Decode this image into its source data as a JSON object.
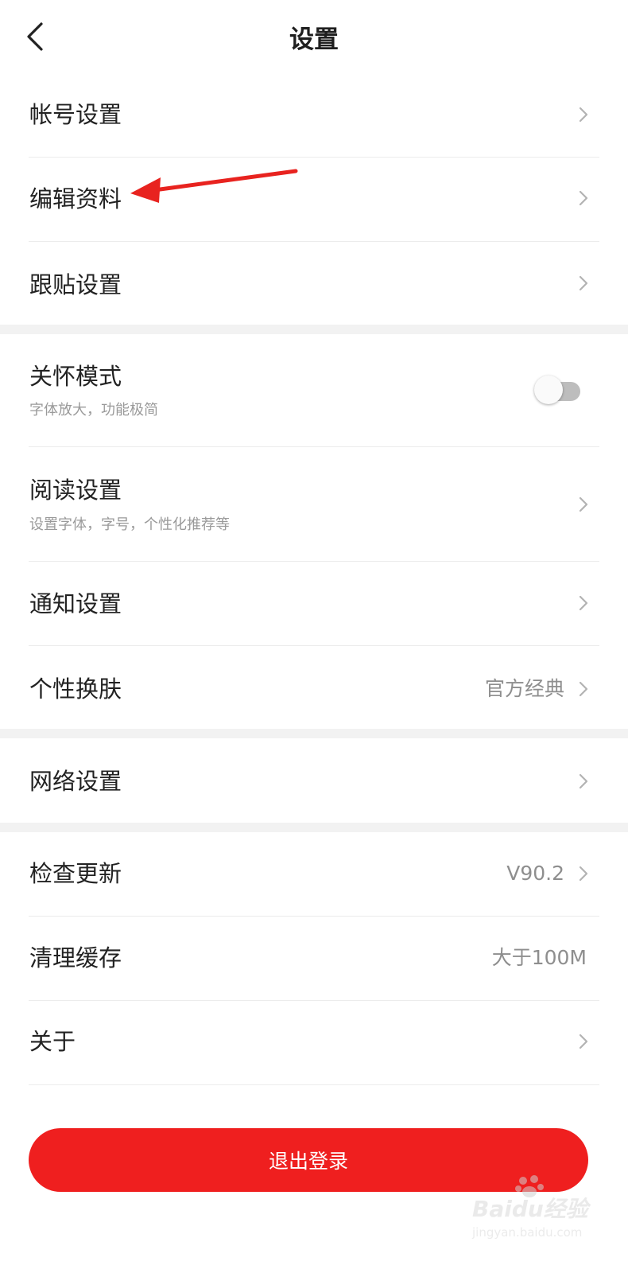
{
  "header": {
    "title": "设置"
  },
  "groups": [
    {
      "items": [
        {
          "label": "帐号设置"
        },
        {
          "label": "编辑资料"
        },
        {
          "label": "跟贴设置"
        }
      ]
    },
    {
      "items": [
        {
          "label": "关怀模式",
          "sub": "字体放大，功能极简",
          "toggle_on": false
        },
        {
          "label": "阅读设置",
          "sub": "设置字体，字号，个性化推荐等"
        },
        {
          "label": "通知设置"
        },
        {
          "label": "个性换肤",
          "value": "官方经典"
        }
      ]
    },
    {
      "items": [
        {
          "label": "网络设置"
        }
      ]
    },
    {
      "items": [
        {
          "label": "检查更新",
          "value": "V90.2"
        },
        {
          "label": "清理缓存",
          "value": "大于100M"
        },
        {
          "label": "关于"
        }
      ]
    }
  ],
  "logout": {
    "label": "退出登录"
  },
  "watermark": {
    "text": "Baidu经验",
    "sub": "jingyan.baidu.com"
  },
  "colors": {
    "accent": "#ef1f1f",
    "annotation": "#e8231f",
    "separator": "#f2f2f2"
  }
}
